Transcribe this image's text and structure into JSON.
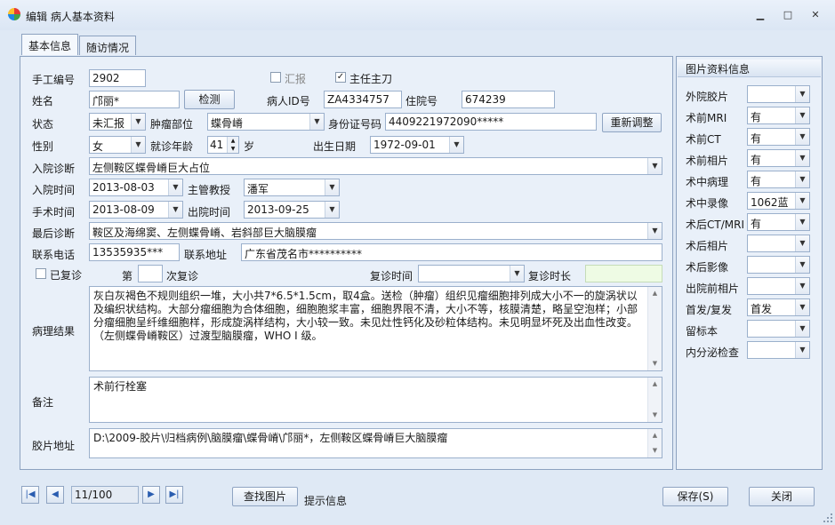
{
  "window": {
    "title": "编辑 病人基本资料",
    "minimize": "▁",
    "maximize": "□",
    "close": "✕"
  },
  "tabs": [
    {
      "label": "基本信息",
      "active": true
    },
    {
      "label": "随访情况",
      "active": false
    }
  ],
  "form": {
    "manual_no_label": "手工编号",
    "manual_no": "2902",
    "report_label": "汇报",
    "report_checked": false,
    "chief_surgeon_label": "主任主刀",
    "chief_surgeon_checked": true,
    "name_label": "姓名",
    "name": "邝丽*",
    "check_button": "检测",
    "patient_id_label": "病人ID号",
    "patient_id": "ZA4334757",
    "inpatient_no_label": "住院号",
    "inpatient_no": "674239",
    "status_label": "状态",
    "status": "未汇报",
    "tumor_site_label": "肿瘤部位",
    "tumor_site": "蝶骨嵴",
    "id_card_label": "身份证号码",
    "id_card": "4409221972090*****",
    "readjust_button": "重新调整",
    "gender_label": "性别",
    "gender": "女",
    "age_label": "就诊年龄",
    "age": "41",
    "age_unit": "岁",
    "birth_label": "出生日期",
    "birth": "1972-09-01",
    "admit_diag_label": "入院诊断",
    "admit_diag": "左侧鞍区蝶骨嵴巨大占位",
    "admit_time_label": "入院时间",
    "admit_time": "2013-08-03",
    "professor_label": "主管教授",
    "professor": "潘军",
    "surgery_time_label": "手术时间",
    "surgery_time": "2013-08-09",
    "discharge_time_label": "出院时间",
    "discharge_time": "2013-09-25",
    "final_diag_label": "最后诊断",
    "final_diag": "鞍区及海绵窦、左侧蝶骨嵴、岩斜部巨大脑膜瘤",
    "phone_label": "联系电话",
    "phone": "13535935***",
    "address_label": "联系地址",
    "address": "广东省茂名市**********",
    "revisited_label": "已复诊",
    "revisited_checked": false,
    "revisit_no_prefix": "第",
    "revisit_no": "",
    "revisit_no_suffix": "次复诊",
    "revisit_time_label": "复诊时间",
    "revisit_time": "",
    "revisit_duration_label": "复诊时长",
    "revisit_duration": "",
    "pathology_label": "病理结果",
    "pathology": "灰白灰褐色不规则组织一堆，大小共7*6.5*1.5cm，取4盒。送检（肿瘤）组织见瘤细胞排列成大小不一的旋涡状以及编织状结构。大部分瘤细胞为合体细胞，细胞胞浆丰富，细胞界限不清，大小不等，核膜清楚，略呈空泡样；小部分瘤细胞呈纤维细胞样，形成旋涡样结构，大小较一致。未见灶性钙化及砂粒体结构。未见明显坏死及出血性改变。（左侧蝶骨嵴鞍区）过渡型脑膜瘤，WHO I 级。",
    "remark_label": "备注",
    "remark": "术前行栓塞",
    "film_addr_label": "胶片地址",
    "film_addr": "D:\\2009-胶片\\归档病例\\脑膜瘤\\蝶骨嵴\\邝丽*，左侧鞍区蝶骨嵴巨大脑膜瘤"
  },
  "image_info": {
    "title": "图片资料信息",
    "rows": [
      {
        "label": "外院胶片",
        "value": ""
      },
      {
        "label": "术前MRI",
        "value": "有"
      },
      {
        "label": "术前CT",
        "value": "有"
      },
      {
        "label": "术前相片",
        "value": "有"
      },
      {
        "label": "术中病理",
        "value": "有"
      },
      {
        "label": "术中录像",
        "value": "1062蓝"
      },
      {
        "label": "术后CT/MRI",
        "value": "有"
      },
      {
        "label": "术后相片",
        "value": ""
      },
      {
        "label": "术后影像",
        "value": ""
      },
      {
        "label": "出院前相片",
        "value": ""
      },
      {
        "label": "首发/复发",
        "value": "首发"
      },
      {
        "label": "留标本",
        "value": ""
      },
      {
        "label": "内分泌检查",
        "value": ""
      }
    ]
  },
  "footer": {
    "record_pos": "11/100",
    "find_image_button": "查找图片",
    "hint": "提示信息",
    "save_button": "保存(S)",
    "close_button": "关闭"
  }
}
